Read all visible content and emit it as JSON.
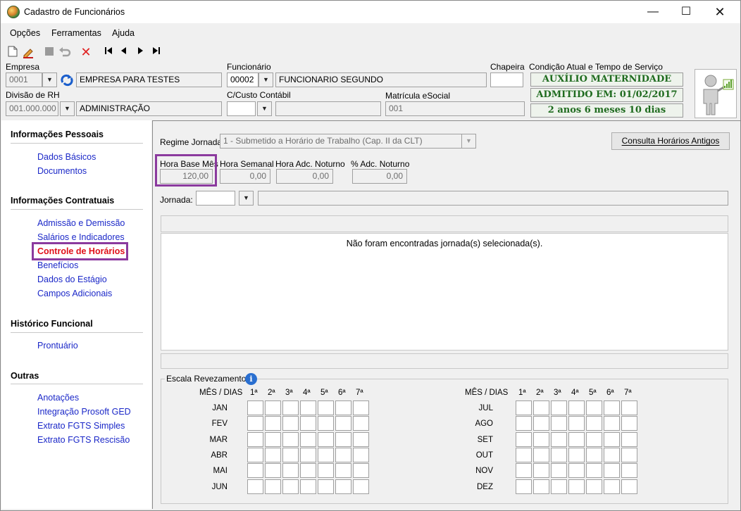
{
  "window": {
    "title": "Cadastro de Funcionários"
  },
  "menu": [
    {
      "label": "Opções"
    },
    {
      "label": "Ferramentas"
    },
    {
      "label": "Ajuda"
    }
  ],
  "header": {
    "empresa_label": "Empresa",
    "empresa_code": "0001",
    "empresa_name": "EMPRESA PARA TESTES",
    "funcionario_label": "Funcionário",
    "funcionario_code": "00002",
    "funcionario_name": "FUNCIONARIO SEGUNDO",
    "chapeira_label": "Chapeira",
    "chapeira_value": "",
    "condicao_label": "Condição Atual e Tempo de Serviço",
    "divisao_label": "Divisão de RH",
    "divisao_code": "001.000.000",
    "divisao_name": "ADMINISTRAÇÃO",
    "custo_label": "C/Custo Contábil",
    "custo_code": "",
    "custo_name": "",
    "matricula_label": "Matrícula eSocial",
    "matricula_value": "001",
    "status_condicao": "AUXÍLIO MATERNIDADE",
    "status_admitido": "ADMITIDO EM: 01/02/2017",
    "status_tempo": "2 anos 6 meses 10 dias"
  },
  "sidebar": {
    "sections": [
      {
        "title": "Informações Pessoais",
        "items": [
          "Dados Básicos",
          "Documentos"
        ]
      },
      {
        "title": "Informações Contratuais",
        "items": [
          "Admissão e Demissão",
          "Salários e Indicadores",
          "Controle de Horários",
          "Benefícios",
          "Dados do Estágio",
          "Campos Adicionais"
        ]
      },
      {
        "title": "Histórico Funcional",
        "items": [
          "Prontuário"
        ]
      },
      {
        "title": "Outras",
        "items": [
          "Anotações",
          "Integração Prosoft GED",
          "Extrato FGTS Simples",
          "Extrato FGTS Rescisão"
        ]
      }
    ],
    "active_item": "Controle de Horários"
  },
  "main": {
    "regime_label": "Regime Jornada",
    "regime_value": "1 - Submetido a Horário de Trabalho (Cap. II da CLT)",
    "consulta_button": "Consulta Horários Antigos",
    "hora_base_label": "Hora Base Mês",
    "hora_base_value": "120,00",
    "hora_semanal_label": "Hora Semanal",
    "hora_semanal_value": "0,00",
    "hora_noturno_label": "Hora Adc. Noturno",
    "hora_noturno_value": "0,00",
    "pct_noturno_label": "% Adc. Noturno",
    "pct_noturno_value": "0,00",
    "jornada_label": "Jornada:",
    "jornada_code": "",
    "jornada_desc": "",
    "empty_message": "Não foram encontradas jornada(s) selecionada(s).",
    "escala_label": "Escala Revezamento",
    "mes_dias_label": "MÊS / DIAS",
    "day_headers": [
      "1ª",
      "2ª",
      "3ª",
      "4ª",
      "5ª",
      "6ª",
      "7ª"
    ],
    "months_left": [
      "JAN",
      "FEV",
      "MAR",
      "ABR",
      "MAI",
      "JUN"
    ],
    "months_right": [
      "JUL",
      "AGO",
      "SET",
      "OUT",
      "NOV",
      "DEZ"
    ]
  },
  "colors": {
    "status_green": "#1f6b1f",
    "link_blue": "#1b28c8",
    "active_red": "#e0101a",
    "highlight_purple": "#8b3a9e"
  }
}
